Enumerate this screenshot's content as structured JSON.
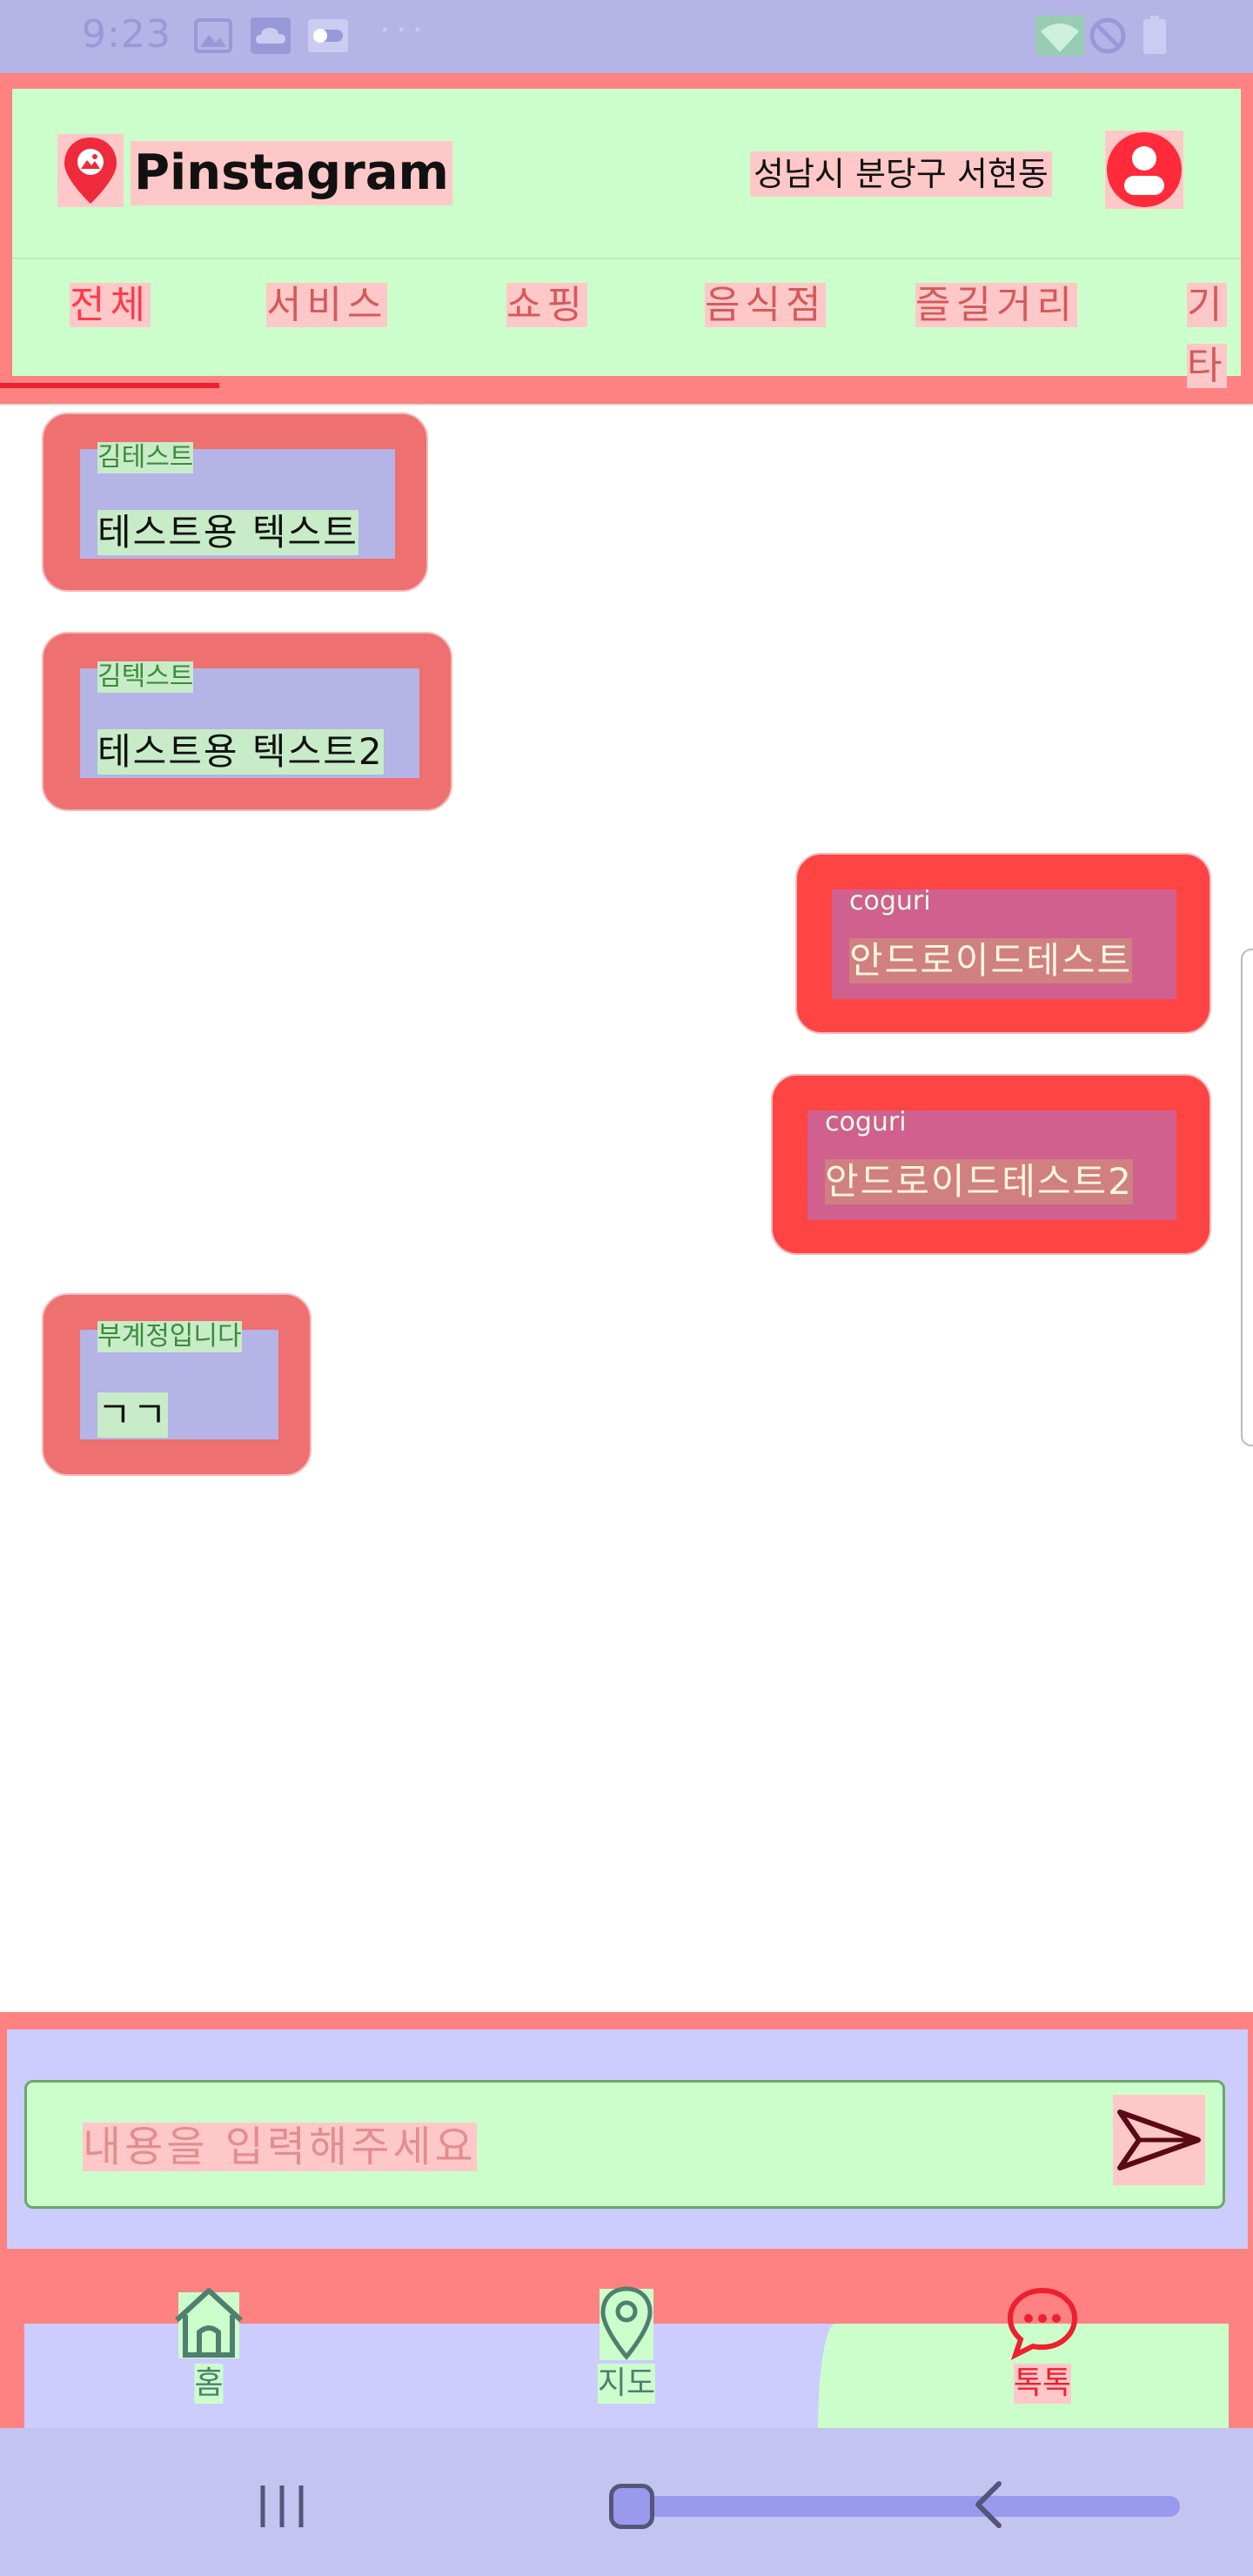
{
  "status_bar": {
    "time": "9:23",
    "icons": [
      "gallery-icon",
      "cloud-icon",
      "toggle-icon",
      "wifi-icon",
      "do-not-disturb-icon",
      "battery-icon"
    ],
    "more": "···"
  },
  "header": {
    "app_name": "Pinstagram",
    "location": "성남시 분당구 서현동",
    "tabs": [
      {
        "label": "전체",
        "active": true
      },
      {
        "label": "서비스",
        "active": false
      },
      {
        "label": "쇼핑",
        "active": false
      },
      {
        "label": "음식점",
        "active": false
      },
      {
        "label": "즐길거리",
        "active": false
      },
      {
        "label": "기타",
        "active": false
      }
    ]
  },
  "messages": [
    {
      "sender": "김테스트",
      "text": "테스트용 텍스트",
      "direction": "incoming"
    },
    {
      "sender": "김텍스트",
      "text": "테스트용 텍스트2",
      "direction": "incoming"
    },
    {
      "sender": "coguri",
      "text": "안드로이드테스트",
      "direction": "outgoing"
    },
    {
      "sender": "coguri",
      "text": "안드로이드테스트2",
      "direction": "outgoing"
    },
    {
      "sender": "부계정입니다",
      "text": "ㄱㄱ",
      "direction": "incoming"
    }
  ],
  "composer": {
    "placeholder": "내용을 입력해주세요"
  },
  "bottom_nav": {
    "items": [
      {
        "label": "홈",
        "icon": "home-icon",
        "active": false
      },
      {
        "label": "지도",
        "icon": "map-pin-icon",
        "active": false
      },
      {
        "label": "톡톡",
        "icon": "chat-icon",
        "active": true
      }
    ]
  },
  "colors": {
    "accent": "#ff3b4a",
    "header_bg": "#ccfecc",
    "incoming_bubble": "#ee7070",
    "outgoing_bubble": "#ff4444"
  }
}
